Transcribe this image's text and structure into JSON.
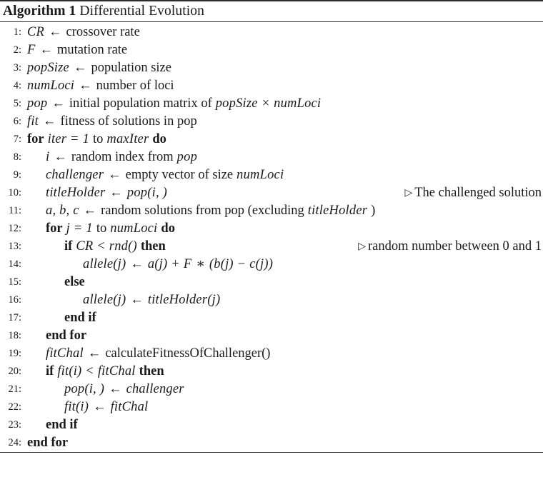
{
  "document": {
    "type": "algorithm-pseudocode-float",
    "caption_name": "Algorithm 1",
    "caption_title": "Differential Evolution",
    "comment_marker": "▷",
    "assign_symbol": "←",
    "text_color": "#1a1a1a",
    "background_color": "#ffffff",
    "rule_color": "#2b2b2b"
  },
  "lines": [
    {
      "no": "1",
      "indent": 0,
      "tokens": [
        {
          "t": "va",
          "s": "CR"
        },
        {
          "t": "op",
          "s": "←"
        },
        {
          "t": "ro",
          "s": "crossover rate"
        }
      ],
      "comment": ""
    },
    {
      "no": "2",
      "indent": 0,
      "tokens": [
        {
          "t": "va",
          "s": "F"
        },
        {
          "t": "op",
          "s": "←"
        },
        {
          "t": "ro",
          "s": "mutation rate"
        }
      ],
      "comment": ""
    },
    {
      "no": "3",
      "indent": 0,
      "tokens": [
        {
          "t": "va",
          "s": "popSize"
        },
        {
          "t": "op",
          "s": "←"
        },
        {
          "t": "ro",
          "s": "population size"
        }
      ],
      "comment": ""
    },
    {
      "no": "4",
      "indent": 0,
      "tokens": [
        {
          "t": "va",
          "s": "numLoci"
        },
        {
          "t": "op",
          "s": "←"
        },
        {
          "t": "ro",
          "s": "number of loci"
        }
      ],
      "comment": ""
    },
    {
      "no": "5",
      "indent": 0,
      "tokens": [
        {
          "t": "va",
          "s": "pop"
        },
        {
          "t": "op",
          "s": "←"
        },
        {
          "t": "ro",
          "s": "initial population matrix of"
        },
        {
          "t": "va",
          "s": "popSize"
        },
        {
          "t": "op",
          "s": "×"
        },
        {
          "t": "va",
          "s": "numLoci"
        }
      ],
      "comment": ""
    },
    {
      "no": "6",
      "indent": 0,
      "tokens": [
        {
          "t": "va",
          "s": "fit"
        },
        {
          "t": "op",
          "s": "←"
        },
        {
          "t": "ro",
          "s": "fitness of solutions in pop"
        }
      ],
      "comment": ""
    },
    {
      "no": "7",
      "indent": 0,
      "tokens": [
        {
          "t": "kw",
          "s": "for"
        },
        {
          "t": "va",
          "s": "iter"
        },
        {
          "t": "op",
          "s": "="
        },
        {
          "t": "va",
          "s": "1"
        },
        {
          "t": "ro",
          "s": "to"
        },
        {
          "t": "va",
          "s": "maxIter"
        },
        {
          "t": "kw",
          "s": "do"
        }
      ],
      "comment": ""
    },
    {
      "no": "8",
      "indent": 1,
      "tokens": [
        {
          "t": "va",
          "s": "i"
        },
        {
          "t": "op",
          "s": "←"
        },
        {
          "t": "ro",
          "s": "random index from"
        },
        {
          "t": "va",
          "s": "pop"
        }
      ],
      "comment": ""
    },
    {
      "no": "9",
      "indent": 1,
      "tokens": [
        {
          "t": "va",
          "s": "challenger"
        },
        {
          "t": "op",
          "s": "←"
        },
        {
          "t": "ro",
          "s": "empty vector of size"
        },
        {
          "t": "va",
          "s": "numLoci"
        }
      ],
      "comment": ""
    },
    {
      "no": "10",
      "indent": 1,
      "tokens": [
        {
          "t": "va",
          "s": "titleHolder"
        },
        {
          "t": "op",
          "s": "←"
        },
        {
          "t": "va",
          "s": "pop(i, )"
        }
      ],
      "comment": "The challenged solution"
    },
    {
      "no": "11",
      "indent": 1,
      "tokens": [
        {
          "t": "va",
          "s": "a, b, c"
        },
        {
          "t": "op",
          "s": "←"
        },
        {
          "t": "ro",
          "s": "random solutions from pop (excluding"
        },
        {
          "t": "va",
          "s": "titleHolder"
        },
        {
          "t": "ro",
          "s": ")"
        }
      ],
      "comment": ""
    },
    {
      "no": "12",
      "indent": 1,
      "tokens": [
        {
          "t": "kw",
          "s": "for"
        },
        {
          "t": "va",
          "s": "j"
        },
        {
          "t": "op",
          "s": "="
        },
        {
          "t": "va",
          "s": "1"
        },
        {
          "t": "ro",
          "s": "to"
        },
        {
          "t": "va",
          "s": "numLoci"
        },
        {
          "t": "kw",
          "s": "do"
        }
      ],
      "comment": ""
    },
    {
      "no": "13",
      "indent": 2,
      "tokens": [
        {
          "t": "kw",
          "s": "if"
        },
        {
          "t": "va",
          "s": "CR"
        },
        {
          "t": "op",
          "s": "<"
        },
        {
          "t": "va",
          "s": "rnd()"
        },
        {
          "t": "kw",
          "s": "then"
        }
      ],
      "comment": "random number between 0 and 1"
    },
    {
      "no": "14",
      "indent": 3,
      "tokens": [
        {
          "t": "va",
          "s": "allele(j)"
        },
        {
          "t": "op",
          "s": "←"
        },
        {
          "t": "va",
          "s": "a(j)"
        },
        {
          "t": "op",
          "s": "+"
        },
        {
          "t": "va",
          "s": "F"
        },
        {
          "t": "op",
          "s": "∗"
        },
        {
          "t": "va",
          "s": "(b(j)"
        },
        {
          "t": "op",
          "s": "−"
        },
        {
          "t": "va",
          "s": "c(j))"
        }
      ],
      "comment": ""
    },
    {
      "no": "15",
      "indent": 2,
      "tokens": [
        {
          "t": "kw",
          "s": "else"
        }
      ],
      "comment": ""
    },
    {
      "no": "16",
      "indent": 3,
      "tokens": [
        {
          "t": "va",
          "s": "allele(j)"
        },
        {
          "t": "op",
          "s": "←"
        },
        {
          "t": "va",
          "s": "titleHolder(j)"
        }
      ],
      "comment": ""
    },
    {
      "no": "17",
      "indent": 2,
      "tokens": [
        {
          "t": "kw",
          "s": "end if"
        }
      ],
      "comment": ""
    },
    {
      "no": "18",
      "indent": 1,
      "tokens": [
        {
          "t": "kw",
          "s": "end for"
        }
      ],
      "comment": ""
    },
    {
      "no": "19",
      "indent": 1,
      "tokens": [
        {
          "t": "va",
          "s": "fitChal"
        },
        {
          "t": "op",
          "s": "←"
        },
        {
          "t": "ro",
          "s": "calculateFitnessOfChallenger()"
        }
      ],
      "comment": ""
    },
    {
      "no": "20",
      "indent": 1,
      "tokens": [
        {
          "t": "kw",
          "s": "if"
        },
        {
          "t": "va",
          "s": "fit(i)"
        },
        {
          "t": "op",
          "s": "<"
        },
        {
          "t": "va",
          "s": "fitChal"
        },
        {
          "t": "kw",
          "s": "then"
        }
      ],
      "comment": ""
    },
    {
      "no": "21",
      "indent": 2,
      "tokens": [
        {
          "t": "va",
          "s": "pop(i, )"
        },
        {
          "t": "op",
          "s": "←"
        },
        {
          "t": "va",
          "s": "challenger"
        }
      ],
      "comment": ""
    },
    {
      "no": "22",
      "indent": 2,
      "tokens": [
        {
          "t": "va",
          "s": "fit(i)"
        },
        {
          "t": "op",
          "s": "←"
        },
        {
          "t": "va",
          "s": "fitChal"
        }
      ],
      "comment": ""
    },
    {
      "no": "23",
      "indent": 1,
      "tokens": [
        {
          "t": "kw",
          "s": "end if"
        }
      ],
      "comment": ""
    },
    {
      "no": "24",
      "indent": 0,
      "tokens": [
        {
          "t": "kw",
          "s": "end for"
        }
      ],
      "comment": ""
    }
  ]
}
